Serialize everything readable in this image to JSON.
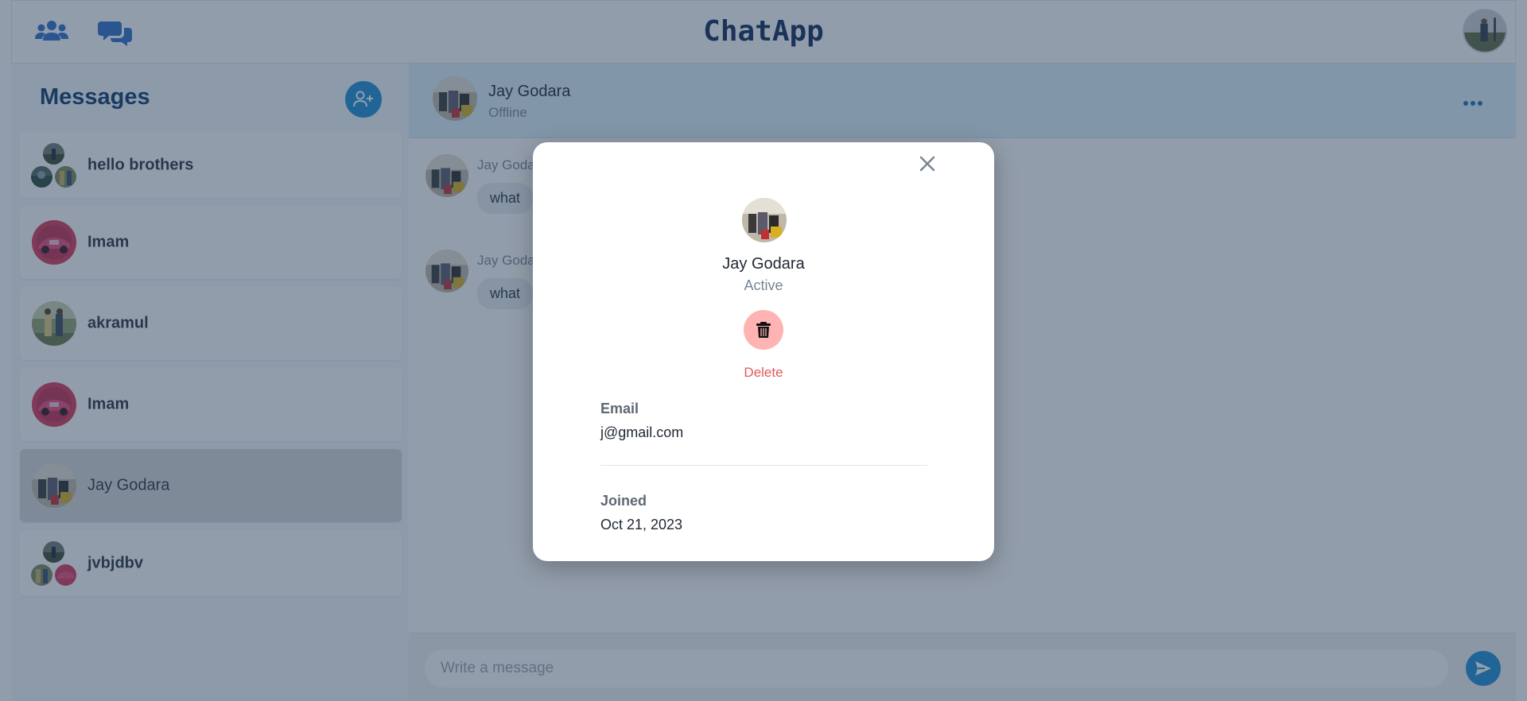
{
  "app": {
    "title": "ChatApp"
  },
  "sidebar": {
    "title": "Messages",
    "conversations": [
      {
        "name": "hello brothers",
        "type": "group"
      },
      {
        "name": "Imam",
        "type": "user"
      },
      {
        "name": "akramul",
        "type": "user"
      },
      {
        "name": "Imam",
        "type": "user"
      },
      {
        "name": "Jay Godara",
        "type": "user",
        "selected": true
      },
      {
        "name": "jvbjdbv",
        "type": "group"
      }
    ]
  },
  "chat": {
    "header": {
      "name": "Jay Godara",
      "status": "Offline"
    },
    "messages": [
      {
        "sender": "Jay Godara",
        "text": "what"
      },
      {
        "sender": "Jay Godara",
        "text": "what"
      }
    ],
    "composer": {
      "placeholder": "Write a message"
    }
  },
  "modal": {
    "name": "Jay Godara",
    "status": "Active",
    "delete_label": "Delete",
    "email_label": "Email",
    "email_value": "j@gmail.com",
    "joined_label": "Joined",
    "joined_value": "Oct 21, 2023"
  },
  "colors": {
    "brand": "#0f2a5a",
    "accent": "#1d8fd6",
    "danger": "#e05a5a",
    "danger_bg": "#ffb3b3"
  },
  "icons": {
    "nav_users": "users-icon",
    "nav_chats": "chat-bubbles-icon",
    "add_user": "user-plus-icon",
    "more": "more-horizontal-icon",
    "send": "send-icon",
    "close": "close-icon",
    "delete": "trash-icon"
  }
}
